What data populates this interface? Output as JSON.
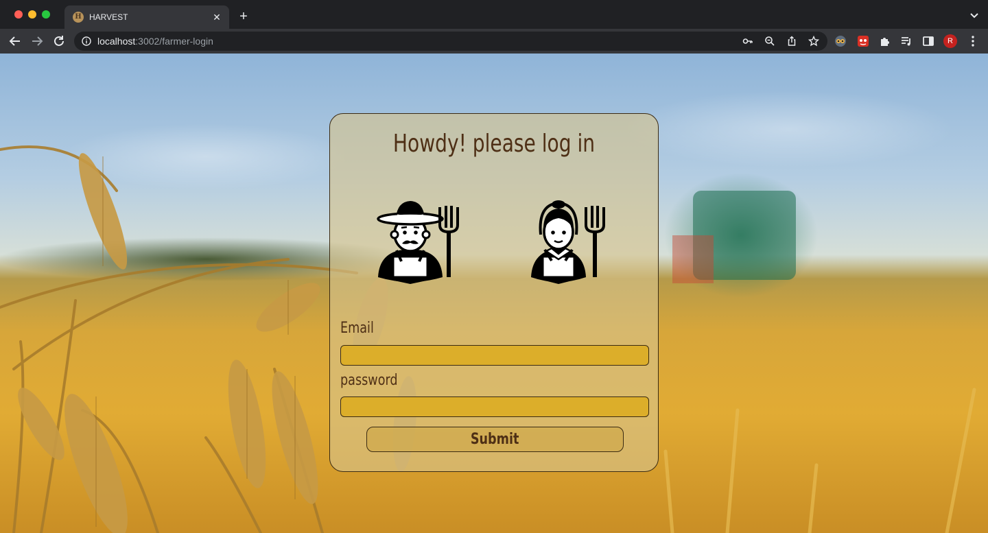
{
  "browser": {
    "tab": {
      "title": "HARVEST",
      "favicon_letter": "H"
    },
    "url": {
      "host": "localhost",
      "path": ":3002/farmer-login"
    },
    "profile_initial": "R",
    "icons": {
      "back": "arrow-left-icon",
      "forward": "arrow-right-icon",
      "reload": "reload-icon",
      "site_info": "info-icon",
      "key": "key-icon",
      "zoom": "zoom-out-icon",
      "share": "share-icon",
      "bookmark": "star-icon",
      "extensions": "puzzle-icon",
      "media": "media-playlist-icon",
      "side_panel": "side-panel-icon",
      "menu": "kebab-menu-icon"
    }
  },
  "login": {
    "title": "Howdy! please log in",
    "email_label": "Email",
    "email_value": "",
    "password_label": "password",
    "password_value": "",
    "submit_label": "Submit",
    "avatars": [
      "farmer-man-icon",
      "farmer-woman-icon"
    ]
  },
  "colors": {
    "title_text": "#4e2f15",
    "input_fill": "#dcae2a",
    "card_border": "#3a2a12"
  }
}
